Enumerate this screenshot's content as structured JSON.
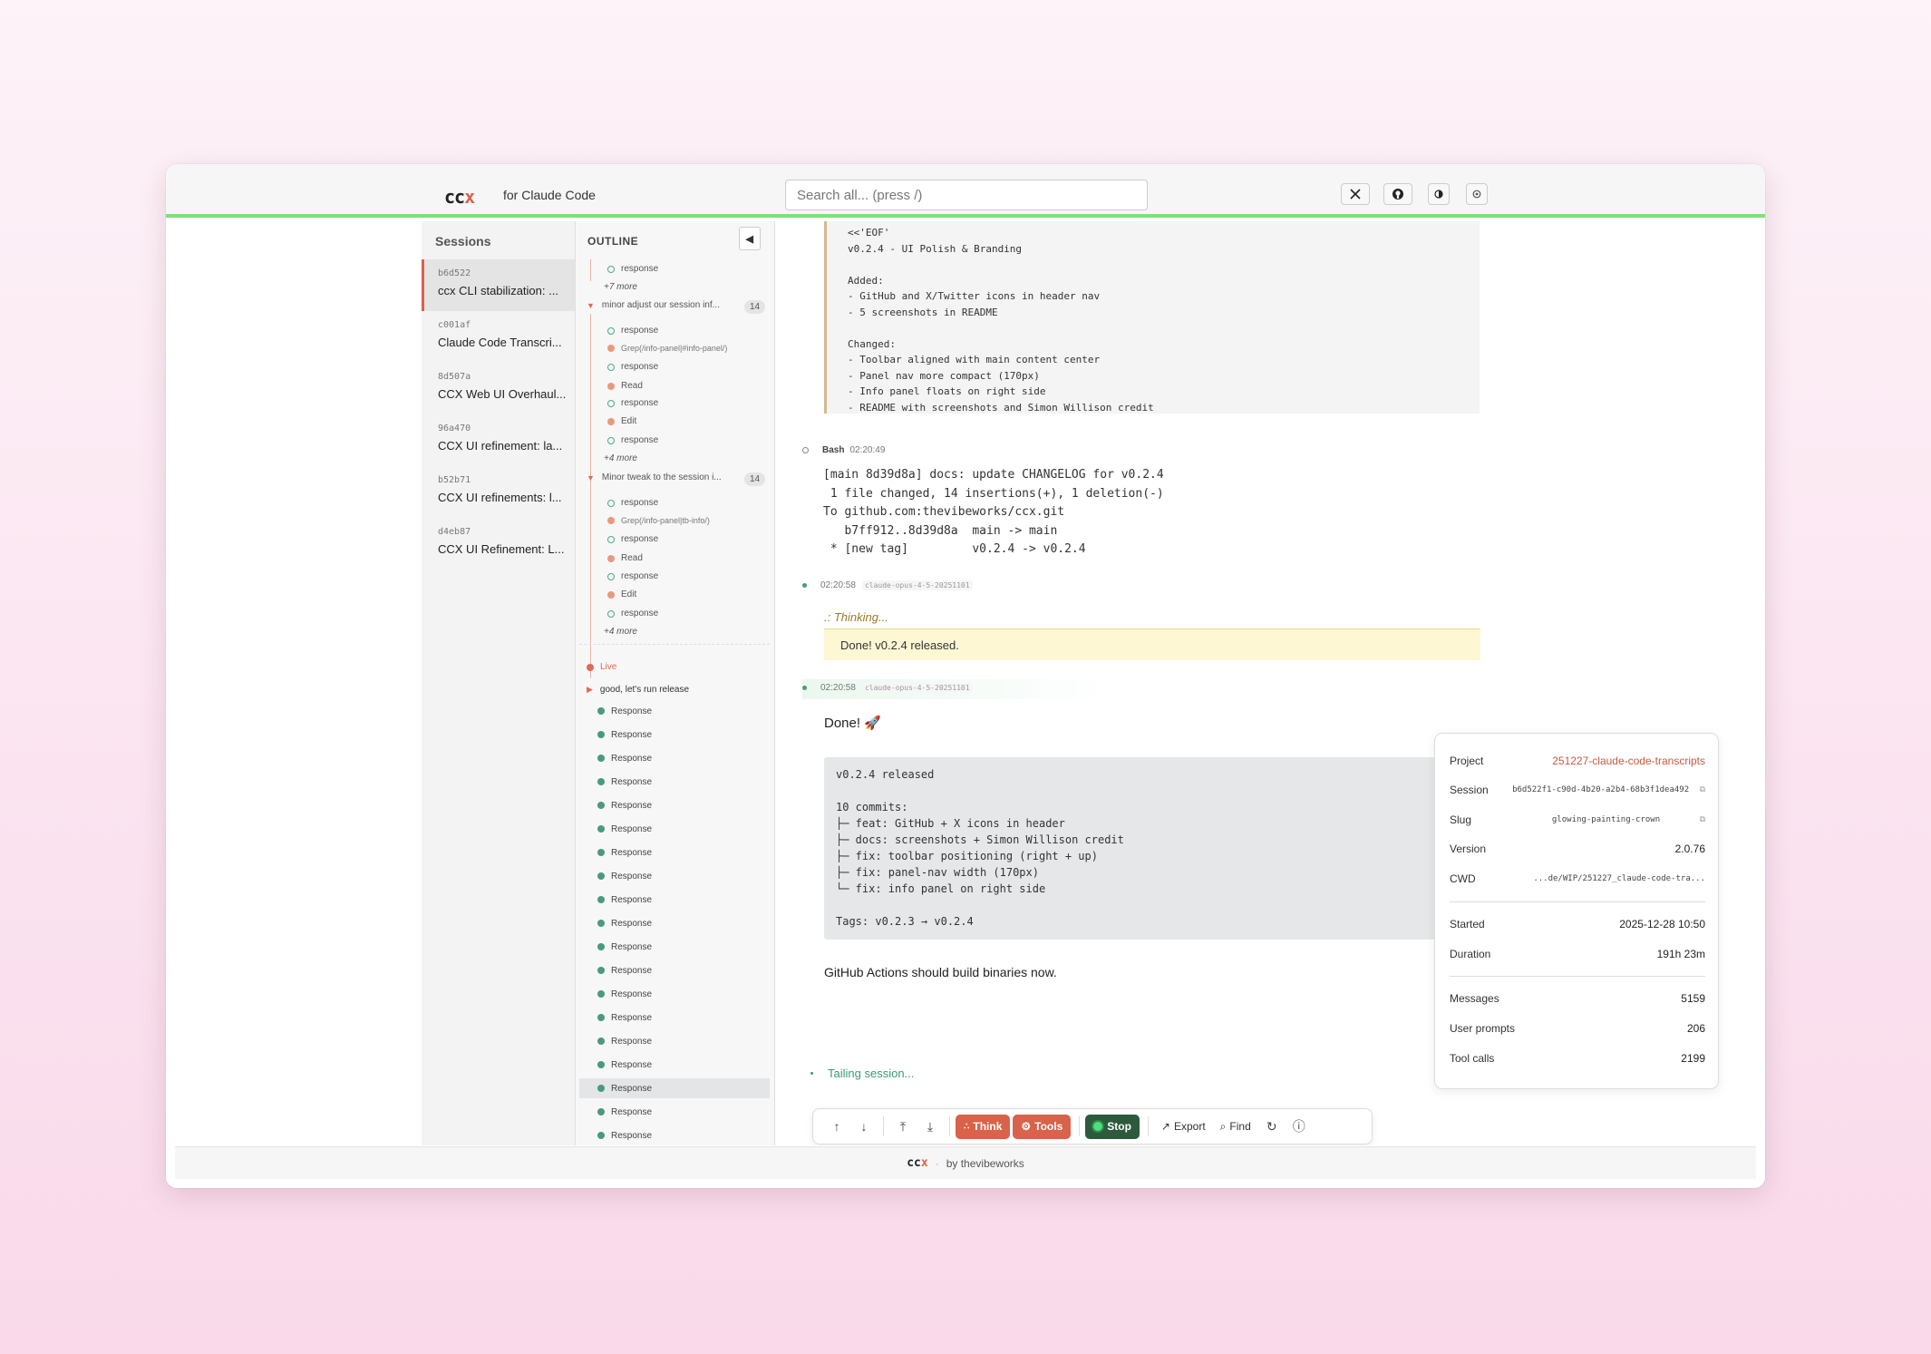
{
  "app": {
    "logo_main": "cc",
    "logo_x": "x",
    "tagline": "for Claude Code"
  },
  "search": {
    "placeholder": "Search all... (press /)"
  },
  "header_icons": [
    "x-twitter-icon",
    "github-icon",
    "theme-toggle-icon",
    "settings-icon"
  ],
  "sessions": {
    "title": "Sessions",
    "items": [
      {
        "id": "b6d522",
        "title": "ccx CLI stabilization: ..."
      },
      {
        "id": "c001af",
        "title": "Claude Code Transcri..."
      },
      {
        "id": "8d507a",
        "title": "CCX Web UI Overhaul..."
      },
      {
        "id": "96a470",
        "title": "CCX UI refinement: la..."
      },
      {
        "id": "b52b71",
        "title": "CCX UI refinements: l..."
      },
      {
        "id": "d4eb87",
        "title": "CCX UI Refinement: L..."
      }
    ]
  },
  "outline": {
    "title": "OUTLINE",
    "collapse": "◀",
    "top": {
      "item": "response",
      "more": "+7 more"
    },
    "group1": {
      "title": "minor adjust our session inf...",
      "count": "14",
      "items": [
        "response",
        "Grep(/info-panel|#info-panel/)",
        "response",
        "Read",
        "response",
        "Edit",
        "response"
      ],
      "more": "+4 more"
    },
    "group2": {
      "title": "Minor tweak to the session i...",
      "count": "14",
      "items": [
        "response",
        "Grep(/info-panel|tb-info/)",
        "response",
        "Read",
        "response",
        "Edit",
        "response"
      ],
      "more": "+4 more"
    },
    "live": "Live",
    "live_group": "good, let's run release",
    "responses": [
      "Response",
      "Response",
      "Response",
      "Response",
      "Response",
      "Response",
      "Response",
      "Response",
      "Response",
      "Response",
      "Response",
      "Response",
      "Response",
      "Response",
      "Response",
      "Response",
      "Response",
      "Response",
      "Response"
    ]
  },
  "main": {
    "heredoc": "<<'EOF'\nv0.2.4 - UI Polish & Branding\n\nAdded:\n- GitHub and X/Twitter icons in header nav\n- 5 screenshots in README\n\nChanged:\n- Toolbar aligned with main content center\n- Panel nav more compact (170px)\n- Info panel floats on right side\n- README with screenshots and Simon Willison credit",
    "bash": {
      "label": "Bash",
      "time": "02:20:49"
    },
    "bash_output": "[main 8d39d8a] docs: update CHANGELOG for v0.2.4\n 1 file changed, 14 insertions(+), 1 deletion(-)\nTo github.com:thevibeworks/ccx.git\n   b7ff912..8d39d8a  main -> main\n * [new tag]         v0.2.4 -> v0.2.4",
    "msg1": {
      "time": "02:20:58",
      "model": "claude-opus-4-5-20251101"
    },
    "thinking": ".: Thinking...",
    "thinking_text": "Done! v0.2.4 released.",
    "msg2": {
      "time": "02:20:58",
      "model": "claude-opus-4-5-20251101"
    },
    "done": "Done! 🚀",
    "release": "v0.2.4 released\n\n10 commits:\n├─ feat: GitHub + X icons in header\n├─ docs: screenshots + Simon Willison credit\n├─ fix: toolbar positioning (right + up)\n├─ fix: panel-nav width (170px)\n└─ fix: info panel on right side\n\nTags: v0.2.3 → v0.2.4",
    "gh": "GitHub Actions should build binaries now.",
    "tailing": "Tailing session..."
  },
  "toolbar": {
    "think": "Think",
    "tools": "Tools",
    "stop": "Stop",
    "export": "Export",
    "find": "Find"
  },
  "info": {
    "project_label": "Project",
    "project": "251227-claude-code-transcripts",
    "session_label": "Session",
    "session": "b6d522f1-c90d-4b20-a2b4-68b3f1dea492",
    "slug_label": "Slug",
    "slug": "glowing-painting-crown",
    "version_label": "Version",
    "version": "2.0.76",
    "cwd_label": "CWD",
    "cwd": "...de/WIP/251227_claude-code-tra...",
    "started_label": "Started",
    "started": "2025-12-28 10:50",
    "duration_label": "Duration",
    "duration": "191h 23m",
    "messages_label": "Messages",
    "messages": "5159",
    "prompts_label": "User prompts",
    "prompts": "206",
    "tools_label": "Tool calls",
    "tools": "2199"
  },
  "footer": {
    "logo_main": "cc",
    "logo_x": "x",
    "sep": "·",
    "by": "by thevibeworks"
  }
}
